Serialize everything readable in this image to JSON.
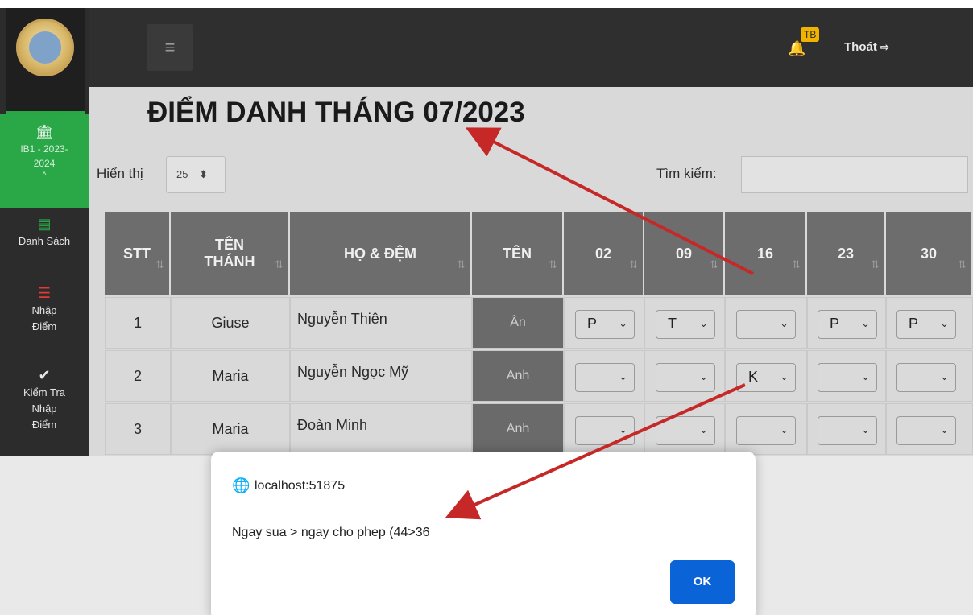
{
  "sidebar": {
    "active_item": {
      "label": "IB1 - 2023-2024",
      "chevron": "^"
    },
    "items": [
      {
        "label": "Danh Sách",
        "icon": "list-icon"
      },
      {
        "label": "Nhập Điểm",
        "icon": "bars-icon"
      },
      {
        "label": "Kiểm Tra Nhập Điểm",
        "icon": "check-icon"
      }
    ]
  },
  "topbar": {
    "menu_icon": "≡",
    "badge": "TB",
    "logout_label": "Thoát"
  },
  "page": {
    "title": "ĐIỂM DANH THÁNG 07/2023",
    "show_label": "Hiển thị",
    "page_size": "25",
    "search_label": "Tìm kiếm:"
  },
  "table": {
    "headers": [
      "STT",
      "TÊN THÁNH",
      "HỌ & ĐỆM",
      "TÊN",
      "02",
      "09",
      "16",
      "23",
      "30"
    ],
    "rows": [
      {
        "stt": "1",
        "ten_thanh": "Giuse",
        "ho_dem": "Nguyễn Thiên",
        "ten": "Ân",
        "days": [
          "P",
          "T",
          "",
          "P",
          "P"
        ]
      },
      {
        "stt": "2",
        "ten_thanh": "Maria",
        "ho_dem": "Nguyễn Ngọc Mỹ",
        "ten": "Anh",
        "days": [
          "",
          "",
          "K",
          "",
          ""
        ]
      },
      {
        "stt": "3",
        "ten_thanh": "Maria",
        "ho_dem": "Đoàn Minh",
        "ten": "Anh",
        "days": [
          "",
          "",
          "",
          "",
          ""
        ]
      }
    ]
  },
  "dialog": {
    "host": "localhost:51875",
    "message": "Ngay sua > ngay cho phep (44>36",
    "ok_label": "OK"
  },
  "colors": {
    "sidebar_active": "#2aa848",
    "topbar": "#2f2f2f",
    "ok_button": "#0b63d8",
    "badge": "#f0b400",
    "arrow": "#c62828"
  }
}
